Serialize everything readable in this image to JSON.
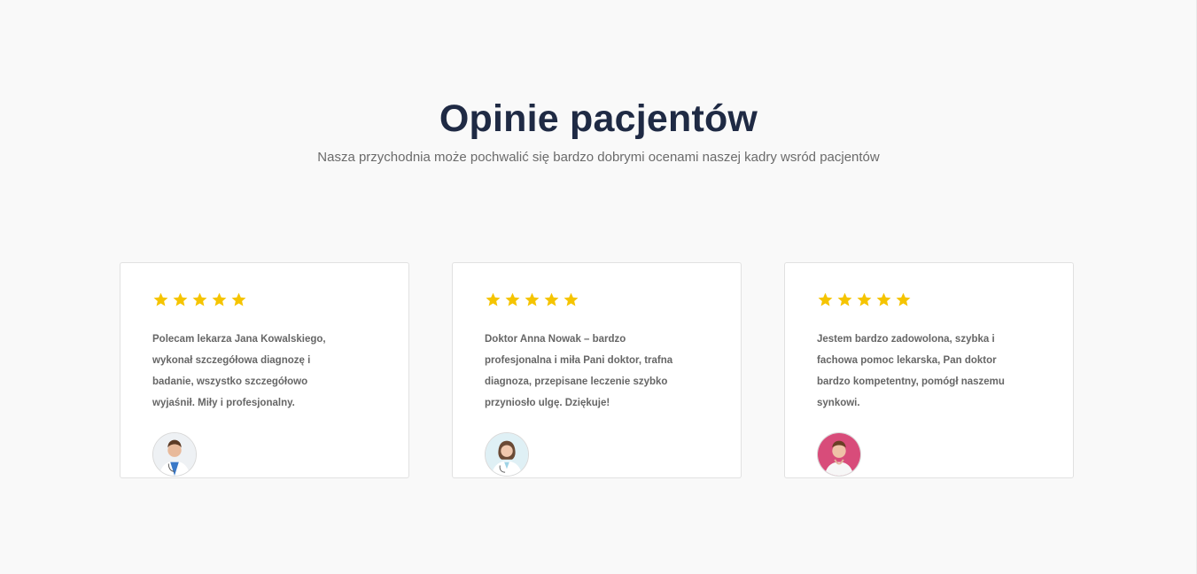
{
  "section": {
    "title": "Opinie pacjentów",
    "subtitle": "Nasza przychodnia może pochwalić się bardzo dobrymi ocenami naszej kadry wsród pacjentów"
  },
  "colors": {
    "title": "#1f2a44",
    "subtitle": "#6b6b6b",
    "star": "#f5c400",
    "card_border": "#e1e1e1",
    "background": "#f9f9f9"
  },
  "testimonials": [
    {
      "rating": 5,
      "text": "Polecam lekarza Jana Kowalskiego, wykonał szczegółowa diagnozę i badanie, wszystko szczegółowo wyjaśnił. Miły i profesjonalny.",
      "avatar_icon": "doctor-avatar"
    },
    {
      "rating": 5,
      "text": "Doktor Anna Nowak – bardzo profesjonalna i miła Pani doktor, trafna diagnoza, przepisane leczenie szybko przyniosło ulgę. Dziękuje!",
      "avatar_icon": "doctor-avatar"
    },
    {
      "rating": 5,
      "text": "Jestem bardzo zadowolona, szybka i fachowa pomoc lekarska, Pan doktor bardzo kompetentny, pomógł naszemu synkowi.",
      "avatar_icon": "doctor-avatar"
    }
  ]
}
